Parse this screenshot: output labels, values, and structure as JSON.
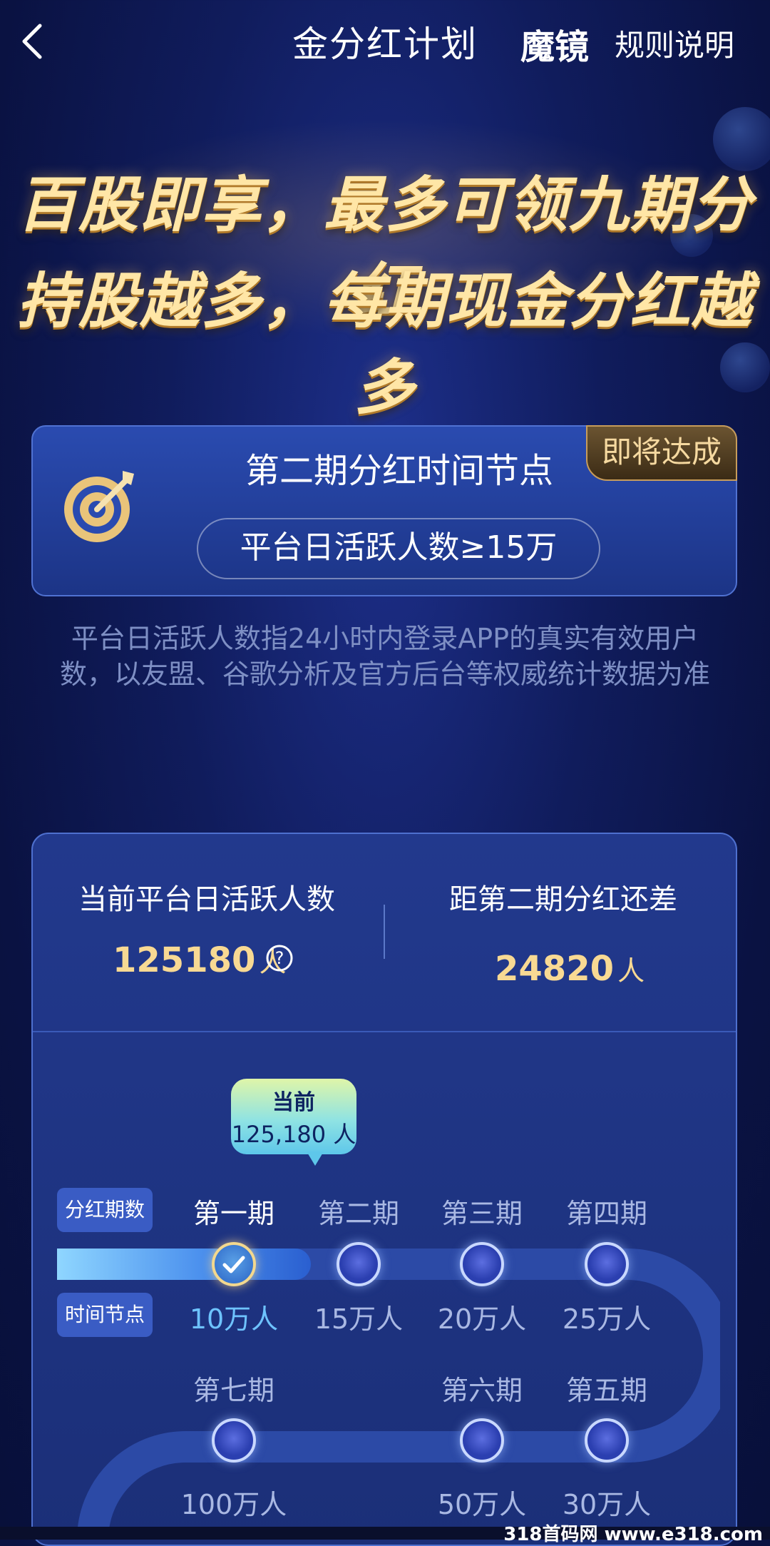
{
  "nav": {
    "title": "金分红计划",
    "brand": "魔镜",
    "rules": "规则说明"
  },
  "hero": {
    "line1": "百股即享，最多可领九期分红",
    "line2": "持股越多，每期现金分红越多"
  },
  "milestone": {
    "title": "第二期分红时间节点",
    "badge": "即将达成",
    "threshold": "平台日活跃人数≥15万"
  },
  "description": "平台日活跃人数指24小时内登录APP的真实有效用户数，以友盟、谷歌分析及官方后台等权威统计数据为准",
  "stats": {
    "current_label": "当前平台日活跃人数",
    "current_value": "125180",
    "current_unit": "人",
    "remaining_label": "距第二期分红还差",
    "remaining_value": "24820",
    "remaining_unit": "人"
  },
  "tooltip": {
    "title": "当前",
    "value": "125,180 人"
  },
  "timeline": {
    "period_tag": "分红期数",
    "node_tag": "时间节点",
    "row1": [
      {
        "period": "第一期",
        "node": "10万人",
        "done": true
      },
      {
        "period": "第二期",
        "node": "15万人",
        "done": false
      },
      {
        "period": "第三期",
        "node": "20万人",
        "done": false
      },
      {
        "period": "第四期",
        "node": "25万人",
        "done": false
      }
    ],
    "row2": [
      {
        "period": "第七期",
        "node": "100万人"
      },
      {
        "period": "第六期",
        "node": "50万人"
      },
      {
        "period": "第五期",
        "node": "30万人"
      }
    ]
  },
  "watermark": "318首码网 www.e318.com"
}
